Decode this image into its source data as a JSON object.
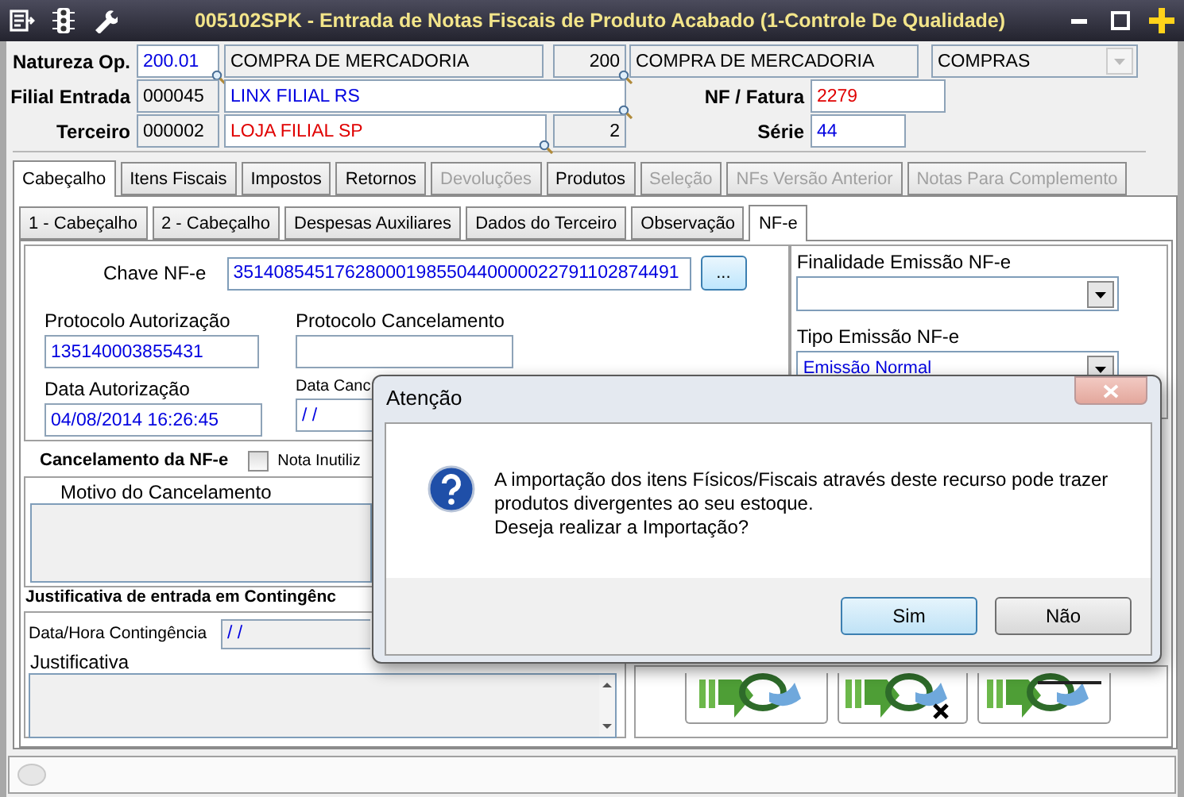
{
  "window": {
    "title": "005102SPK - Entrada de Notas Fiscais de Produto Acabado (1-Controle De Qualidade)"
  },
  "header": {
    "natureza_op": {
      "label": "Natureza Op.",
      "code": "200.01",
      "description": "COMPRA DE MERCADORIA",
      "number": "200",
      "description_2": "COMPRA DE MERCADORIA",
      "group": {
        "value": "COMPRAS",
        "disabled": true
      }
    },
    "filial_entrada": {
      "label": "Filial Entrada",
      "code": "000045",
      "name": "LINX FILIAL RS"
    },
    "terceiro": {
      "label": "Terceiro",
      "code": "000002",
      "name": "LOJA FILIAL SP",
      "number": "2"
    },
    "nf_fatura": {
      "label": "NF / Fatura",
      "value": "2279"
    },
    "serie": {
      "label": "Série",
      "value": "44"
    }
  },
  "tabs": [
    {
      "label": "Cabeçalho",
      "selected": true,
      "disabled": false
    },
    {
      "label": "Itens Fiscais",
      "selected": false,
      "disabled": false
    },
    {
      "label": "Impostos",
      "selected": false,
      "disabled": false
    },
    {
      "label": "Retornos",
      "selected": false,
      "disabled": false
    },
    {
      "label": "Devoluções",
      "selected": false,
      "disabled": true
    },
    {
      "label": "Produtos",
      "selected": false,
      "disabled": false
    },
    {
      "label": "Seleção",
      "selected": false,
      "disabled": true
    },
    {
      "label": "NFs Versão Anterior",
      "selected": false,
      "disabled": true
    },
    {
      "label": "Notas Para Complemento",
      "selected": false,
      "disabled": true
    }
  ],
  "subtabs": [
    {
      "label": "1 - Cabeçalho",
      "selected": false
    },
    {
      "label": "2 - Cabeçalho",
      "selected": false
    },
    {
      "label": "Despesas Auxiliares",
      "selected": false
    },
    {
      "label": "Dados do Terceiro",
      "selected": false
    },
    {
      "label": "Observação",
      "selected": false
    },
    {
      "label": "NF-e",
      "selected": true
    }
  ],
  "nfe": {
    "chave": {
      "label": "Chave NF-e",
      "value": "35140854517628000198550440000022791102874491",
      "button": "..."
    },
    "protocolo_autorizacao": {
      "label": "Protocolo Autorização",
      "value": "135140003855431"
    },
    "protocolo_cancelamento": {
      "label": "Protocolo Cancelamento"
    },
    "data_autorizacao": {
      "label": "Data Autorização",
      "value": "04/08/2014 16:26:45"
    },
    "data_cancelamento": {
      "label": "Data Canc",
      "value": "/ /"
    },
    "cancelamento": {
      "title": "Cancelamento da NF-e",
      "nota_inutilizada": {
        "label": "Nota Inutiliz",
        "checked": false
      },
      "motivo_label": "Motivo do Cancelamento"
    },
    "contingencia": {
      "title": "Justificativa de entrada em Contingênc",
      "data_hora": {
        "label": "Data/Hora Contingência",
        "value": "/ /"
      },
      "justificativa_label": "Justificativa"
    },
    "finalidade": {
      "label": "Finalidade Emissão NF-e"
    },
    "tipo_emissao": {
      "label": "Tipo Emissão NF-e",
      "value": "Emissão Normal"
    }
  },
  "dialog": {
    "title": "Atenção",
    "message": "A importação dos itens Físicos/Fiscais através deste recurso pode trazer\nprodutos divergentes ao seu estoque.\nDeseja realizar a Importação?",
    "buttons": [
      {
        "label": "Sim",
        "selected": true
      },
      {
        "label": "Não",
        "selected": false
      }
    ]
  }
}
